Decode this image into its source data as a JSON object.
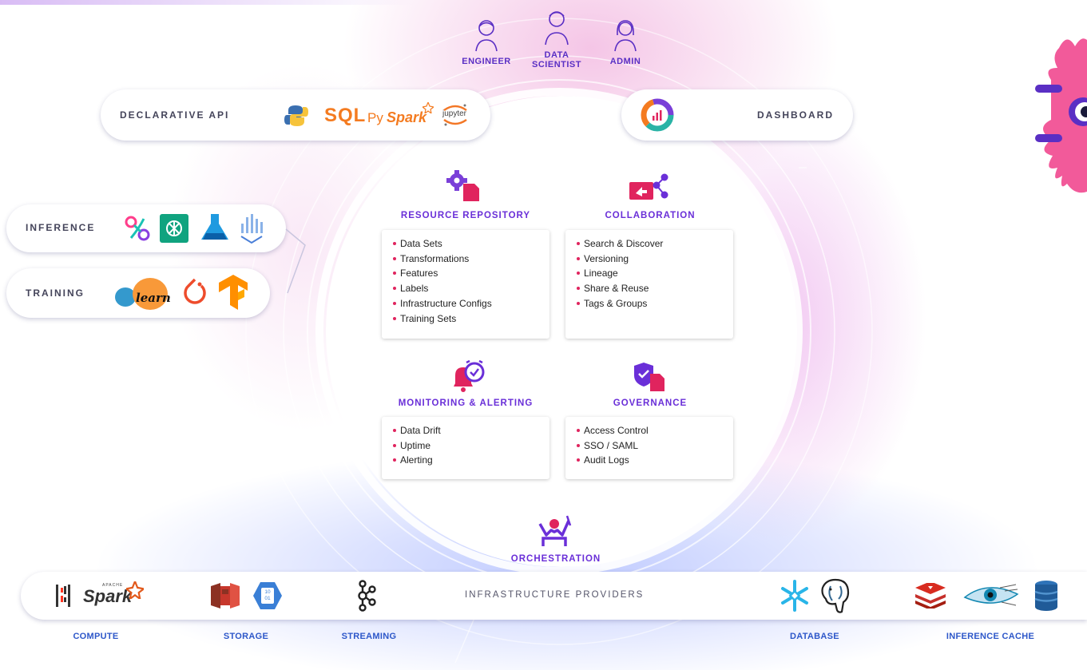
{
  "personas": [
    "ENGINEER",
    "DATA",
    "SCIENTIST",
    "ADMIN"
  ],
  "top_left": {
    "label": "DECLARATIVE API",
    "logos": [
      "python-logo",
      "SQL",
      "Py",
      "Spark",
      "jupyter"
    ]
  },
  "top_right": {
    "label": "DASHBOARD",
    "icon": "dashboard-chart-icon"
  },
  "left": {
    "inference_label": "INFERENCE",
    "training_label": "TRAINING",
    "learn_text": "learn"
  },
  "sections": [
    {
      "title": "RESOURCE REPOSITORY",
      "icon": "gear-file-icon",
      "items": [
        "Data Sets",
        "Transformations",
        "Features",
        "Labels",
        "Infrastructure Configs",
        "Training Sets"
      ]
    },
    {
      "title": "COLLABORATION",
      "icon": "share-screen-icon",
      "items": [
        "Search & Discover",
        "Versioning",
        "Lineage",
        "Share & Reuse",
        "Tags & Groups"
      ]
    },
    {
      "title": "MONITORING & ALERTING",
      "icon": "bell-clock-icon",
      "items": [
        "Data Drift",
        "Uptime",
        "Alerting"
      ]
    },
    {
      "title": "GOVERNANCE",
      "icon": "shield-file-icon",
      "items": [
        "Access Control",
        "SSO / SAML",
        "Audit Logs"
      ]
    }
  ],
  "orchestration": {
    "label": "ORCHESTRATION",
    "icon": "orchestration-icon"
  },
  "infrastructure": {
    "label": "INFRASTRUCTURE PROVIDERS",
    "spark_text": "Spark",
    "apache_text": "APACHE",
    "azure_text": "10\n01",
    "groups": [
      "COMPUTE",
      "STORAGE",
      "STREAMING",
      "DATABASE",
      "INFERENCE CACHE"
    ]
  },
  "colors": {
    "purple": "#6a2fd8",
    "pink_accent": "#e0245e",
    "blue_label": "#2d57c9",
    "orange": "#f47b20",
    "azure": "#3a7fd6"
  }
}
